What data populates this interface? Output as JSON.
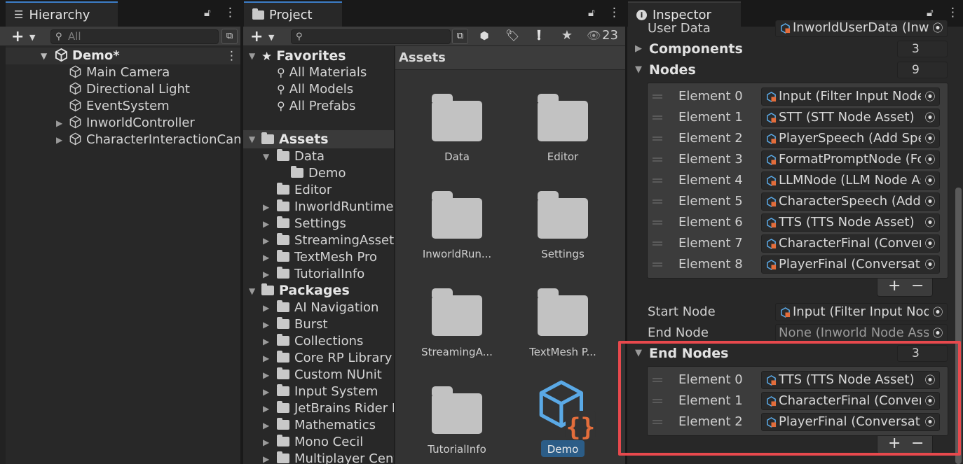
{
  "hierarchy": {
    "tab_label": "Hierarchy",
    "search_placeholder": "All",
    "scene_name": "Demo*",
    "items": [
      {
        "label": "Main Camera"
      },
      {
        "label": "Directional Light"
      },
      {
        "label": "EventSystem"
      },
      {
        "label": "InworldController"
      },
      {
        "label": "CharacterInteractionCanva"
      }
    ]
  },
  "project": {
    "tab_label": "Project",
    "hidden_count": "23",
    "favorites_label": "Favorites",
    "favorites": [
      {
        "label": "All Materials"
      },
      {
        "label": "All Models"
      },
      {
        "label": "All Prefabs"
      }
    ],
    "assets_label": "Assets",
    "assets_tree": [
      {
        "label": "Data"
      },
      {
        "label": "Demo"
      },
      {
        "label": "Editor"
      },
      {
        "label": "InworldRuntime"
      },
      {
        "label": "Settings"
      },
      {
        "label": "StreamingAssets"
      },
      {
        "label": "TextMesh Pro"
      },
      {
        "label": "TutorialInfo"
      }
    ],
    "packages_label": "Packages",
    "packages": [
      {
        "label": "AI Navigation"
      },
      {
        "label": "Burst"
      },
      {
        "label": "Collections"
      },
      {
        "label": "Core RP Library"
      },
      {
        "label": "Custom NUnit"
      },
      {
        "label": "Input System"
      },
      {
        "label": "JetBrains Rider E"
      },
      {
        "label": "Mathematics"
      },
      {
        "label": "Mono Cecil"
      },
      {
        "label": "Multiplayer Cent"
      }
    ],
    "grid_title": "Assets",
    "grid_items": [
      {
        "label": "Data"
      },
      {
        "label": "Editor"
      },
      {
        "label": "InworldRun..."
      },
      {
        "label": "Settings"
      },
      {
        "label": "StreamingA..."
      },
      {
        "label": "TextMesh P..."
      },
      {
        "label": "TutorialInfo"
      },
      {
        "label": "Demo"
      }
    ]
  },
  "inspector": {
    "tab_label": "Inspector",
    "user_data_label": "User Data",
    "user_data_value": "InworldUserData (Inwo",
    "components_label": "Components",
    "components_count": "3",
    "nodes_label": "Nodes",
    "nodes_count": "9",
    "nodes": [
      {
        "label": "Element 0",
        "value": "Input (Filter Input Node A"
      },
      {
        "label": "Element 1",
        "value": "STT (STT Node Asset)"
      },
      {
        "label": "Element 2",
        "value": "PlayerSpeech (Add Spee"
      },
      {
        "label": "Element 3",
        "value": "FormatPromptNode (For"
      },
      {
        "label": "Element 4",
        "value": "LLMNode (LLM Node As"
      },
      {
        "label": "Element 5",
        "value": "CharacterSpeech (Add S"
      },
      {
        "label": "Element 6",
        "value": "TTS (TTS Node Asset)"
      },
      {
        "label": "Element 7",
        "value": "CharacterFinal (Convers"
      },
      {
        "label": "Element 8",
        "value": "PlayerFinal (Conversatio"
      }
    ],
    "start_node_label": "Start Node",
    "start_node_value": "Input (Filter Input Node",
    "end_node_label": "End Node",
    "end_node_value": "None (Inworld Node Asse",
    "end_nodes_label": "End Nodes",
    "end_nodes_count": "3",
    "end_nodes": [
      {
        "label": "Element 0",
        "value": "TTS (TTS Node Asset)"
      },
      {
        "label": "Element 1",
        "value": "CharacterFinal (Convers"
      },
      {
        "label": "Element 2",
        "value": "PlayerFinal (Conversatio"
      }
    ],
    "highlight_color": "#e8494d"
  }
}
